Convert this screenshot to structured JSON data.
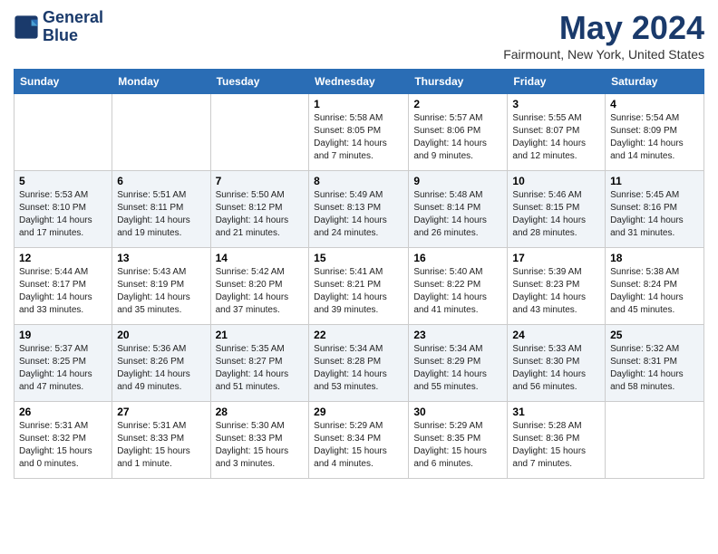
{
  "header": {
    "logo_line1": "General",
    "logo_line2": "Blue",
    "month_title": "May 2024",
    "location": "Fairmount, New York, United States"
  },
  "weekdays": [
    "Sunday",
    "Monday",
    "Tuesday",
    "Wednesday",
    "Thursday",
    "Friday",
    "Saturday"
  ],
  "weeks": [
    [
      {
        "day": "",
        "info": ""
      },
      {
        "day": "",
        "info": ""
      },
      {
        "day": "",
        "info": ""
      },
      {
        "day": "1",
        "info": "Sunrise: 5:58 AM\nSunset: 8:05 PM\nDaylight: 14 hours\nand 7 minutes."
      },
      {
        "day": "2",
        "info": "Sunrise: 5:57 AM\nSunset: 8:06 PM\nDaylight: 14 hours\nand 9 minutes."
      },
      {
        "day": "3",
        "info": "Sunrise: 5:55 AM\nSunset: 8:07 PM\nDaylight: 14 hours\nand 12 minutes."
      },
      {
        "day": "4",
        "info": "Sunrise: 5:54 AM\nSunset: 8:09 PM\nDaylight: 14 hours\nand 14 minutes."
      }
    ],
    [
      {
        "day": "5",
        "info": "Sunrise: 5:53 AM\nSunset: 8:10 PM\nDaylight: 14 hours\nand 17 minutes."
      },
      {
        "day": "6",
        "info": "Sunrise: 5:51 AM\nSunset: 8:11 PM\nDaylight: 14 hours\nand 19 minutes."
      },
      {
        "day": "7",
        "info": "Sunrise: 5:50 AM\nSunset: 8:12 PM\nDaylight: 14 hours\nand 21 minutes."
      },
      {
        "day": "8",
        "info": "Sunrise: 5:49 AM\nSunset: 8:13 PM\nDaylight: 14 hours\nand 24 minutes."
      },
      {
        "day": "9",
        "info": "Sunrise: 5:48 AM\nSunset: 8:14 PM\nDaylight: 14 hours\nand 26 minutes."
      },
      {
        "day": "10",
        "info": "Sunrise: 5:46 AM\nSunset: 8:15 PM\nDaylight: 14 hours\nand 28 minutes."
      },
      {
        "day": "11",
        "info": "Sunrise: 5:45 AM\nSunset: 8:16 PM\nDaylight: 14 hours\nand 31 minutes."
      }
    ],
    [
      {
        "day": "12",
        "info": "Sunrise: 5:44 AM\nSunset: 8:17 PM\nDaylight: 14 hours\nand 33 minutes."
      },
      {
        "day": "13",
        "info": "Sunrise: 5:43 AM\nSunset: 8:19 PM\nDaylight: 14 hours\nand 35 minutes."
      },
      {
        "day": "14",
        "info": "Sunrise: 5:42 AM\nSunset: 8:20 PM\nDaylight: 14 hours\nand 37 minutes."
      },
      {
        "day": "15",
        "info": "Sunrise: 5:41 AM\nSunset: 8:21 PM\nDaylight: 14 hours\nand 39 minutes."
      },
      {
        "day": "16",
        "info": "Sunrise: 5:40 AM\nSunset: 8:22 PM\nDaylight: 14 hours\nand 41 minutes."
      },
      {
        "day": "17",
        "info": "Sunrise: 5:39 AM\nSunset: 8:23 PM\nDaylight: 14 hours\nand 43 minutes."
      },
      {
        "day": "18",
        "info": "Sunrise: 5:38 AM\nSunset: 8:24 PM\nDaylight: 14 hours\nand 45 minutes."
      }
    ],
    [
      {
        "day": "19",
        "info": "Sunrise: 5:37 AM\nSunset: 8:25 PM\nDaylight: 14 hours\nand 47 minutes."
      },
      {
        "day": "20",
        "info": "Sunrise: 5:36 AM\nSunset: 8:26 PM\nDaylight: 14 hours\nand 49 minutes."
      },
      {
        "day": "21",
        "info": "Sunrise: 5:35 AM\nSunset: 8:27 PM\nDaylight: 14 hours\nand 51 minutes."
      },
      {
        "day": "22",
        "info": "Sunrise: 5:34 AM\nSunset: 8:28 PM\nDaylight: 14 hours\nand 53 minutes."
      },
      {
        "day": "23",
        "info": "Sunrise: 5:34 AM\nSunset: 8:29 PM\nDaylight: 14 hours\nand 55 minutes."
      },
      {
        "day": "24",
        "info": "Sunrise: 5:33 AM\nSunset: 8:30 PM\nDaylight: 14 hours\nand 56 minutes."
      },
      {
        "day": "25",
        "info": "Sunrise: 5:32 AM\nSunset: 8:31 PM\nDaylight: 14 hours\nand 58 minutes."
      }
    ],
    [
      {
        "day": "26",
        "info": "Sunrise: 5:31 AM\nSunset: 8:32 PM\nDaylight: 15 hours\nand 0 minutes."
      },
      {
        "day": "27",
        "info": "Sunrise: 5:31 AM\nSunset: 8:33 PM\nDaylight: 15 hours\nand 1 minute."
      },
      {
        "day": "28",
        "info": "Sunrise: 5:30 AM\nSunset: 8:33 PM\nDaylight: 15 hours\nand 3 minutes."
      },
      {
        "day": "29",
        "info": "Sunrise: 5:29 AM\nSunset: 8:34 PM\nDaylight: 15 hours\nand 4 minutes."
      },
      {
        "day": "30",
        "info": "Sunrise: 5:29 AM\nSunset: 8:35 PM\nDaylight: 15 hours\nand 6 minutes."
      },
      {
        "day": "31",
        "info": "Sunrise: 5:28 AM\nSunset: 8:36 PM\nDaylight: 15 hours\nand 7 minutes."
      },
      {
        "day": "",
        "info": ""
      }
    ]
  ]
}
